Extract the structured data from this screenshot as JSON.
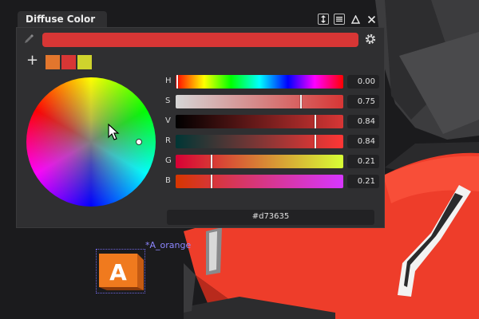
{
  "panel": {
    "title": "Diffuse Color",
    "current_hex": "#d73635",
    "current_color": "#d73635",
    "preset_swatches": [
      {
        "name": "orange",
        "color": "#e2762d"
      },
      {
        "name": "red",
        "color": "#d73635"
      },
      {
        "name": "yellow",
        "color": "#cfd32d"
      }
    ],
    "channels": [
      {
        "label": "H",
        "value": "0.00",
        "fraction": 0.0,
        "gradient": "linear-gradient(90deg,#ff0000,#ffff00 17%,#00ff00 33%,#00ffff 50%,#0000ff 67%,#ff00ff 83%,#ff0000)"
      },
      {
        "label": "S",
        "value": "0.75",
        "fraction": 0.75,
        "gradient": "linear-gradient(90deg,#d6d6d6,#d73635)"
      },
      {
        "label": "V",
        "value": "0.84",
        "fraction": 0.84,
        "gradient": "linear-gradient(90deg,#000000,#d73635)"
      },
      {
        "label": "R",
        "value": "0.84",
        "fraction": 0.84,
        "gradient": "linear-gradient(90deg,#003635,#ff3635)"
      },
      {
        "label": "G",
        "value": "0.21",
        "fraction": 0.21,
        "gradient": "linear-gradient(90deg,#d70035,#d7ff35)"
      },
      {
        "label": "B",
        "value": "0.21",
        "fraction": 0.21,
        "gradient": "linear-gradient(90deg,#d73600,#d736ff)"
      }
    ],
    "wheel_point": {
      "hue": 0.0,
      "saturation": 0.75
    }
  },
  "node": {
    "label": "*A_orange",
    "letter": "A",
    "color": "#e8721e"
  },
  "icons": {
    "window_tools": [
      "resize-icon",
      "menu-icon",
      "maximize-icon",
      "close-icon"
    ]
  }
}
